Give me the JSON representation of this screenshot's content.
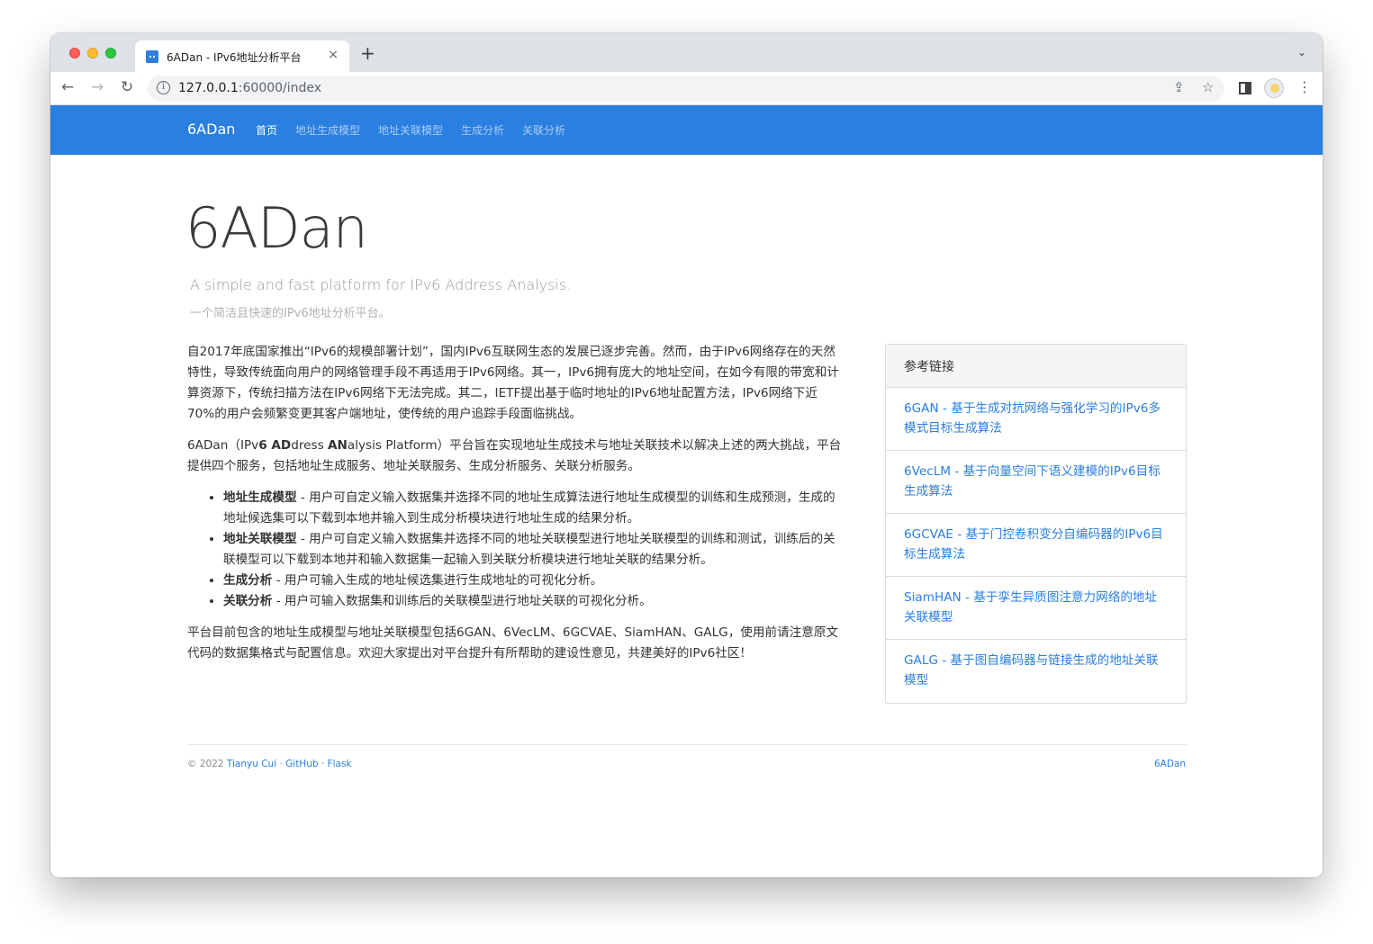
{
  "browser": {
    "tab_title": "6ADan - IPv6地址分析平台",
    "tab_close": "×",
    "new_tab": "+",
    "tabs_menu": "⌄",
    "url_host": "127.0.0.1",
    "url_rest": ":60000/index",
    "icons": {
      "back": "←",
      "forward": "→",
      "reload": "↻",
      "info": "i",
      "share": "⇪",
      "star": "☆",
      "kebab": "⋮"
    }
  },
  "navbar": {
    "brand": "6ADan",
    "items": [
      {
        "label": "首页",
        "active": true
      },
      {
        "label": "地址生成模型",
        "active": false
      },
      {
        "label": "地址关联模型",
        "active": false
      },
      {
        "label": "生成分析",
        "active": false
      },
      {
        "label": "关联分析",
        "active": false
      }
    ],
    "color": "#2a7fe0"
  },
  "hero": {
    "title": "6ADan",
    "lead_en": "A simple and fast platform for IPv6 Address Analysis.",
    "lead_cn": "一个简洁且快速的IPv6地址分析平台。"
  },
  "content": {
    "para1": "自2017年底国家推出“IPv6的规模部署计划”，国内IPv6互联网生态的发展已逐步完善。然而，由于IPv6网络存在的天然特性，导致传统面向用户的网络管理手段不再适用于IPv6网络。其一，IPv6拥有庞大的地址空间，在如今有限的带宽和计算资源下，传统扫描方法在IPv6网络下无法完成。其二，IETF提出基于临时地址的IPv6地址配置方法，IPv6网络下近70%的用户会频繁变更其客户端地址，使传统的用户追踪手段面临挑战。",
    "para2_a": "6ADan（IPv",
    "para2_b1": "6 AD",
    "para2_c": "dress ",
    "para2_b2": "AN",
    "para2_d": "alysis Platform）平台旨在实现地址生成技术与地址关联技术以解决上述的两大挑战，平台提供四个服务，包括地址生成服务、地址关联服务、生成分析服务、关联分析服务。",
    "list": [
      {
        "term": "地址生成模型",
        "desc": " - 用户可自定义输入数据集并选择不同的地址生成算法进行地址生成模型的训练和生成预测，生成的地址候选集可以下载到本地并输入到生成分析模块进行地址生成的结果分析。"
      },
      {
        "term": "地址关联模型",
        "desc": " - 用户可自定义输入数据集并选择不同的地址关联模型进行地址关联模型的训练和测试，训练后的关联模型可以下载到本地并和输入数据集一起输入到关联分析模块进行地址关联的结果分析。"
      },
      {
        "term": "生成分析",
        "desc": " - 用户可输入生成的地址候选集进行生成地址的可视化分析。"
      },
      {
        "term": "关联分析",
        "desc": " - 用户可输入数据集和训练后的关联模型进行地址关联的可视化分析。"
      }
    ],
    "para3": "平台目前包含的地址生成模型与地址关联模型包括6GAN、6VecLM、6GCVAE、SiamHAN、GALG，使用前请注意原文代码的数据集格式与配置信息。欢迎大家提出对平台提升有所帮助的建设性意见，共建美好的IPv6社区！"
  },
  "sidebar": {
    "heading": "参考链接",
    "links": [
      "6GAN - 基于生成对抗网络与强化学习的IPv6多模式目标生成算法",
      "6VecLM - 基于向量空间下语义建模的IPv6目标生成算法",
      "6GCVAE - 基于门控卷积变分自编码器的IPv6目标生成算法",
      "SiamHAN - 基于孪生异质图注意力网络的地址关联模型",
      "GALG - 基于图自编码器与链接生成的地址关联模型"
    ]
  },
  "footer": {
    "copyright": "© 2022 ",
    "author": "Tianyu Cui",
    "sep1": " · ",
    "github": "GitHub",
    "sep2": " · ",
    "flask": "Flask",
    "right": "6ADan"
  }
}
